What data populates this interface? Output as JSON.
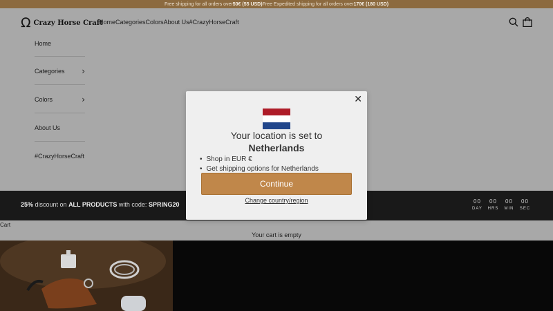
{
  "announcement": {
    "part1": "Free shipping for all orders over ",
    "amount1": "50€ (55 USD)",
    "part2": " Free Expedited shipping for all orders over ",
    "amount2": "170€ (180 USD)"
  },
  "header": {
    "logo_text": "Crazy Horse Craft",
    "nav": [
      "Home",
      "Categories",
      "Colors",
      "About Us",
      "#CrazyHorseCraft"
    ],
    "icons": [
      "search-icon",
      "cart-bag-icon"
    ]
  },
  "sidebar": {
    "items": [
      {
        "label": "Home",
        "chevron": ""
      },
      {
        "label": "Categories",
        "chevron": "›"
      },
      {
        "label": "Colors",
        "chevron": "›"
      },
      {
        "label": "About Us",
        "chevron": ""
      },
      {
        "label": "#CrazyHorseCraft",
        "chevron": ""
      }
    ]
  },
  "promo": {
    "percent": "25%",
    "text1": " discount on ",
    "products": "ALL PRODUCTS",
    "text2": " with code: ",
    "code": "SPRING20",
    "countdown": [
      {
        "value": "00",
        "label": "DAY"
      },
      {
        "value": "00",
        "label": "HRS"
      },
      {
        "value": "00",
        "label": "MIN"
      },
      {
        "value": "00",
        "label": "SEC"
      }
    ]
  },
  "cart": {
    "label": "Cart",
    "empty_text": "Your cart is empty"
  },
  "modal": {
    "line1": "Your location is set to",
    "country": "Netherlands",
    "bullets": [
      "Shop in EUR €",
      "Get shipping options for Netherlands"
    ],
    "continue_label": "Continue",
    "change_label": "Change country/region",
    "close_icon": "close-icon",
    "flag_colors": [
      "#ae1c28",
      "#ffffff",
      "#21468b"
    ]
  },
  "colors": {
    "announcement_bg": "#8c6a3f",
    "button": "#c0874a",
    "promo_bg": "#191919"
  }
}
